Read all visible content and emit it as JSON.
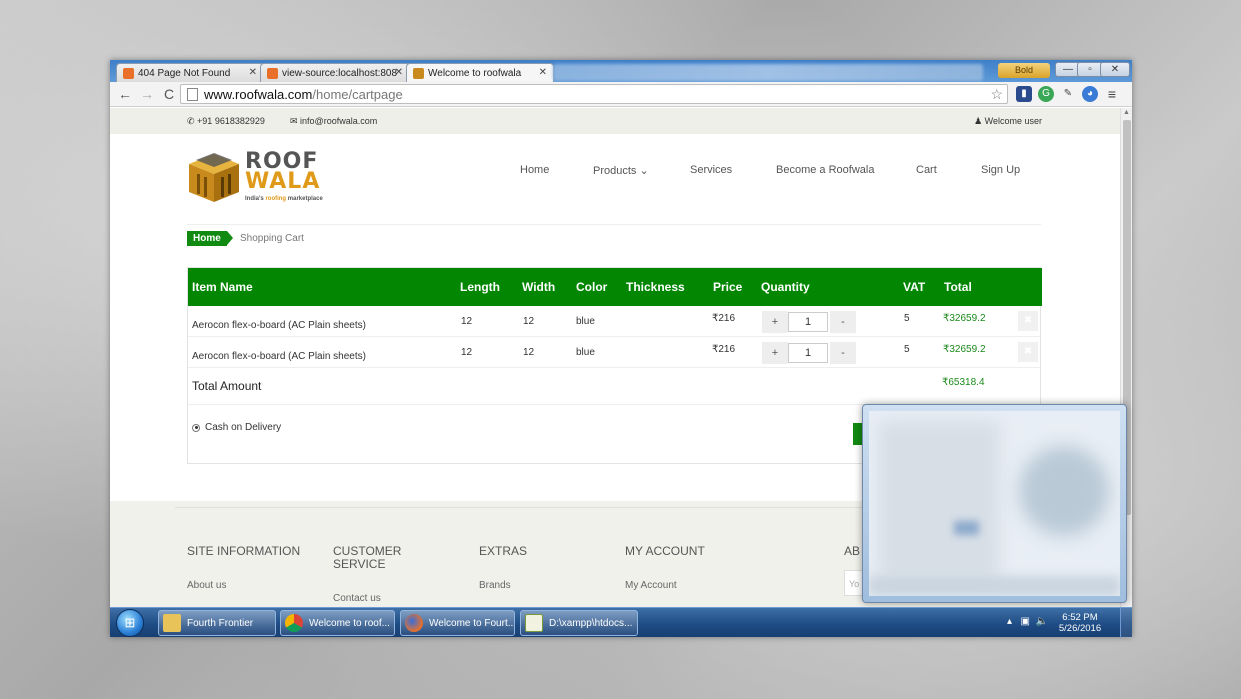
{
  "browser": {
    "tabs": [
      {
        "label": "404 Page Not Found",
        "favicon_color": "#e8702a"
      },
      {
        "label": "view-source:localhost:808",
        "favicon_color": "#e8702a"
      },
      {
        "label": "Welcome to roofwala",
        "favicon_color": "#c98a1d"
      }
    ],
    "window_user": "Bold",
    "url_host": "www.roofwala.com",
    "url_path": "/home/cartpage"
  },
  "topbar": {
    "phone": "+91 9618382929",
    "email": "info@roofwala.com",
    "welcome": "Welcome user"
  },
  "logo": {
    "line1": "ROOF",
    "line2": "WALA",
    "tagline_pre": "India's ",
    "tagline_roof": "roofing",
    "tagline_post": " marketplace"
  },
  "menu": [
    "Home",
    "Products",
    "Services",
    "Become a Roofwala",
    "Cart",
    "Sign Up"
  ],
  "breadcrumb": {
    "home": "Home",
    "current": "Shopping Cart"
  },
  "cart": {
    "headers": [
      "Item Name",
      "Length",
      "Width",
      "Color",
      "Thickness",
      "Price",
      "Quantity",
      "VAT",
      "Total"
    ],
    "rows": [
      {
        "name": "Aerocon flex-o-board (AC Plain sheets)",
        "length": "12",
        "width": "12",
        "color": "blue",
        "thickness": "",
        "price": "₹216",
        "qty": "1",
        "vat": "5",
        "total": "₹32659.2"
      },
      {
        "name": "Aerocon flex-o-board (AC Plain sheets)",
        "length": "12",
        "width": "12",
        "color": "blue",
        "thickness": "",
        "price": "₹216",
        "qty": "1",
        "vat": "5",
        "total": "₹32659.2"
      }
    ],
    "total_label": "Total Amount",
    "total_value": "₹65318.4",
    "payment_option": "Cash on Delivery",
    "plus": "+",
    "minus": "-",
    "remove": "✖"
  },
  "footer": {
    "site_information": "SITE INFORMATION",
    "customer_service": "CUSTOMER SERVICE",
    "extras": "EXTRAS",
    "my_account": "MY ACCOUNT",
    "about_partial": "AB",
    "about_us": "About us",
    "contact_us": "Contact us",
    "brands": "Brands",
    "my_account_link": "My Account",
    "input_partial": "Yo"
  },
  "taskbar": {
    "items": [
      "Fourth Frontier",
      "Welcome to roof...",
      "Welcome to Fourt...",
      "D:\\xampp\\htdocs..."
    ],
    "time": "6:52 PM",
    "date": "5/26/2016"
  },
  "colors": {
    "brand_green": "#038703",
    "accent_orange": "#e09a1a"
  }
}
